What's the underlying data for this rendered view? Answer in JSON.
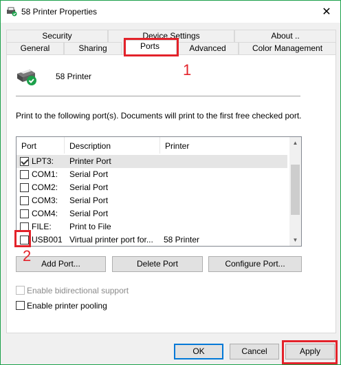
{
  "window": {
    "title": "58 Printer Properties",
    "close_glyph": "✕",
    "border_color": "#1ba04a"
  },
  "tabs": {
    "row1": [
      {
        "label": "Security"
      },
      {
        "label": "Device Settings"
      },
      {
        "label": "About .."
      }
    ],
    "row2": [
      {
        "label": "General"
      },
      {
        "label": "Sharing"
      },
      {
        "label": "Ports"
      },
      {
        "label": "Advanced"
      },
      {
        "label": "Color Management"
      }
    ],
    "active": "Ports"
  },
  "printer": {
    "name": "58 Printer",
    "icon": "printer-with-check-icon"
  },
  "instructions": "Print to the following port(s). Documents will print to the first free checked port.",
  "ports_list": {
    "columns": [
      "Port",
      "Description",
      "Printer"
    ],
    "rows": [
      {
        "port": "LPT3:",
        "description": "Printer Port",
        "printer": "",
        "checked": true,
        "selected": true
      },
      {
        "port": "COM1:",
        "description": "Serial Port",
        "printer": "",
        "checked": false
      },
      {
        "port": "COM2:",
        "description": "Serial Port",
        "printer": "",
        "checked": false
      },
      {
        "port": "COM3:",
        "description": "Serial Port",
        "printer": "",
        "checked": false
      },
      {
        "port": "COM4:",
        "description": "Serial Port",
        "printer": "",
        "checked": false
      },
      {
        "port": "FILE:",
        "description": "Print to File",
        "printer": "",
        "checked": false
      },
      {
        "port": "USB001",
        "description": "Virtual printer port for...",
        "printer": "58 Printer",
        "checked": false
      }
    ]
  },
  "port_buttons": {
    "add": "Add Port...",
    "delete": "Delete Port",
    "configure": "Configure Port..."
  },
  "options": {
    "bidirectional": {
      "label": "Enable bidirectional support",
      "checked": false,
      "enabled": false
    },
    "pooling": {
      "label": "Enable printer pooling",
      "checked": false,
      "enabled": true
    }
  },
  "footer": {
    "ok": "OK",
    "cancel": "Cancel",
    "apply": "Apply"
  },
  "annotations": {
    "marker_1": "1",
    "marker_2": "2",
    "color": "#e3222a"
  }
}
